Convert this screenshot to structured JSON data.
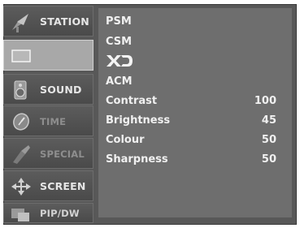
{
  "sidebar": {
    "items": [
      {
        "label": "STATION",
        "icon": "antenna-icon",
        "state": "normal"
      },
      {
        "label": "",
        "icon": "picture-icon",
        "state": "selected"
      },
      {
        "label": "SOUND",
        "icon": "speaker-icon",
        "state": "normal"
      },
      {
        "label": "TIME",
        "icon": "clock-icon",
        "state": "dim"
      },
      {
        "label": "SPECIAL",
        "icon": "special-icon",
        "state": "dim"
      },
      {
        "label": "SCREEN",
        "icon": "move-arrows-icon",
        "state": "normal"
      },
      {
        "label": "PIP/DW",
        "icon": "pip-icon",
        "state": "normal"
      }
    ]
  },
  "picture_menu": {
    "items": [
      {
        "label": "PSM",
        "value": ""
      },
      {
        "label": "CSM",
        "value": ""
      },
      {
        "label": "XD",
        "value": ""
      },
      {
        "label": "ACM",
        "value": ""
      },
      {
        "label": "Contrast",
        "value": "100"
      },
      {
        "label": "Brightness",
        "value": "45"
      },
      {
        "label": "Colour",
        "value": "50"
      },
      {
        "label": "Sharpness",
        "value": "50"
      }
    ]
  },
  "colors": {
    "background": "#585858",
    "panel": "#6e6e6e",
    "selected": "#a8a8a8",
    "text": "#f0f0f0"
  }
}
